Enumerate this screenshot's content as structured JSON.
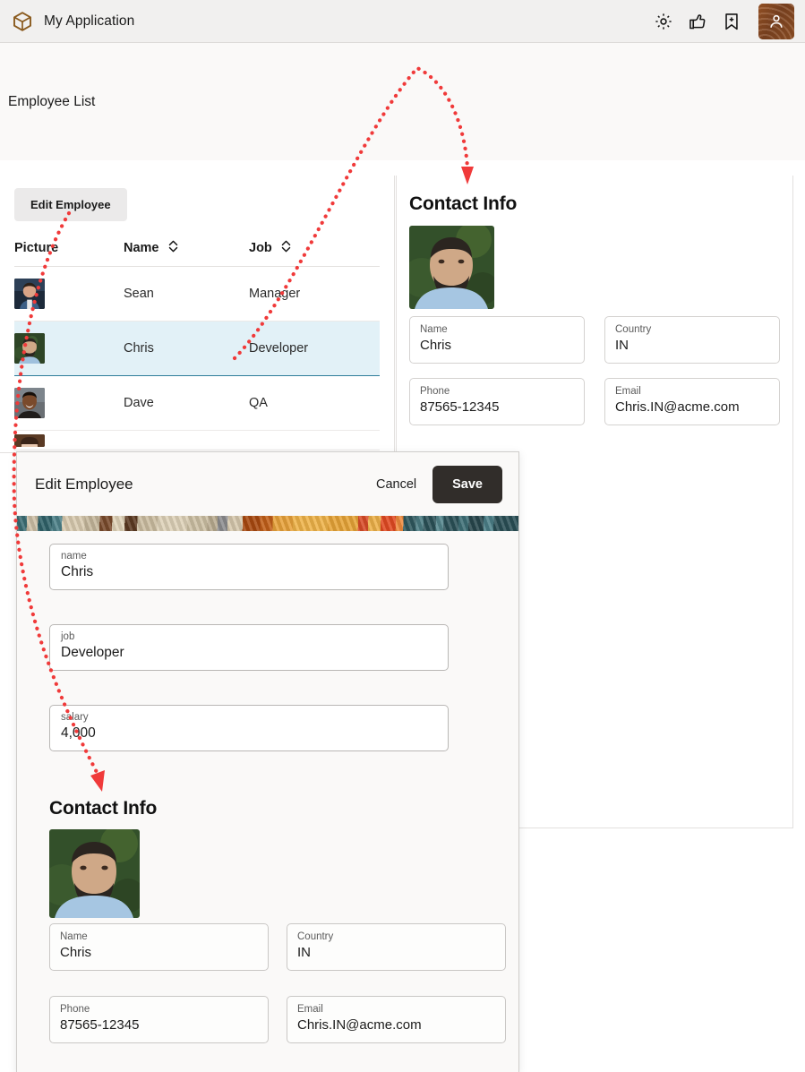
{
  "header": {
    "logo_icon": "cube-logo-icon",
    "app_title": "My Application",
    "icons": [
      {
        "name": "gear-icon",
        "label": "Settings"
      },
      {
        "name": "thumbs-up-icon",
        "label": "Like"
      },
      {
        "name": "bookmark-plus-icon",
        "label": "Bookmark"
      },
      {
        "name": "user-avatar-icon",
        "label": "Account"
      }
    ]
  },
  "page": {
    "title": "Employee List"
  },
  "table": {
    "edit_button_label": "Edit Employee",
    "columns": [
      {
        "label": "Picture",
        "sortable": false
      },
      {
        "label": "Name",
        "sortable": true
      },
      {
        "label": "Job",
        "sortable": true
      }
    ],
    "rows": [
      {
        "name": "Sean",
        "job": "Manager",
        "selected": false
      },
      {
        "name": "Chris",
        "job": "Developer",
        "selected": true
      },
      {
        "name": "Dave",
        "job": "QA",
        "selected": false
      }
    ]
  },
  "contact_info": {
    "title": "Contact Info",
    "fields": [
      {
        "label": "Name",
        "value": "Chris"
      },
      {
        "label": "Country",
        "value": "IN"
      },
      {
        "label": "Phone",
        "value": "87565-12345"
      },
      {
        "label": "Email",
        "value": "Chris.IN@acme.com"
      }
    ]
  },
  "dialog": {
    "title": "Edit Employee",
    "cancel_label": "Cancel",
    "save_label": "Save",
    "fields": [
      {
        "label": "name",
        "value": "Chris"
      },
      {
        "label": "job",
        "value": "Developer"
      },
      {
        "label": "salary",
        "value": "4,000"
      }
    ],
    "contact_info": {
      "title": "Contact Info",
      "fields": [
        {
          "label": "Name",
          "value": "Chris"
        },
        {
          "label": "Country",
          "value": "IN"
        },
        {
          "label": "Phone",
          "value": "87565-12345"
        },
        {
          "label": "Email",
          "value": "Chris.IN@acme.com"
        }
      ]
    }
  },
  "colors": {
    "brand": "#8a5a1e",
    "selected_row_bg": "#e2f1f7",
    "selected_row_border": "#2e7d9a",
    "save_button_bg": "#312d2a",
    "annotation": "#f03a3a",
    "header_bg": "#f1f0ef",
    "page_bg": "#faf9f8"
  }
}
